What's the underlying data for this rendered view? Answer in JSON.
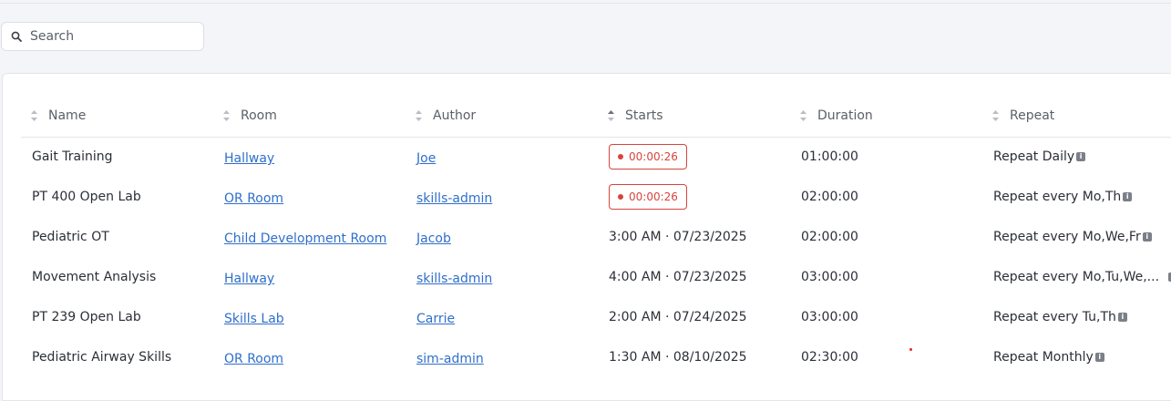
{
  "search": {
    "placeholder": "Search"
  },
  "columns": [
    "Name",
    "Room",
    "Author",
    "Starts",
    "Duration",
    "Repeat"
  ],
  "rows": [
    {
      "name": "Gait Training",
      "room": "Hallway",
      "author": "Joe",
      "starts": "00:00:26",
      "live": true,
      "duration": "01:00:00",
      "repeat": "Repeat Daily"
    },
    {
      "name": "PT 400 Open Lab",
      "room": "OR Room",
      "author": "skills-admin",
      "starts": "00:00:26",
      "live": true,
      "duration": "02:00:00",
      "repeat": "Repeat every Mo,Th"
    },
    {
      "name": "Pediatric OT",
      "room": "Child Development Room",
      "author": "Jacob",
      "starts": "3:00 AM · 07/23/2025",
      "live": false,
      "duration": "02:00:00",
      "repeat": "Repeat every Mo,We,Fr"
    },
    {
      "name": "Movement Analysis",
      "room": "Hallway",
      "author": "skills-admin",
      "starts": "4:00 AM · 07/23/2025",
      "live": false,
      "duration": "03:00:00",
      "repeat": "Repeat every Mo,Tu,We,..."
    },
    {
      "name": "PT 239 Open Lab",
      "room": "Skills Lab",
      "author": "Carrie",
      "starts": "2:00 AM · 07/24/2025",
      "live": false,
      "duration": "03:00:00",
      "repeat": "Repeat every Tu,Th"
    },
    {
      "name": "Pediatric Airway Skills",
      "room": "OR Room",
      "author": "sim-admin",
      "starts": "1:30 AM · 08/10/2025",
      "live": false,
      "duration": "02:30:00",
      "repeat": "Repeat Monthly"
    }
  ],
  "colors": {
    "link": "#2f6fca",
    "live": "#d7443c"
  }
}
